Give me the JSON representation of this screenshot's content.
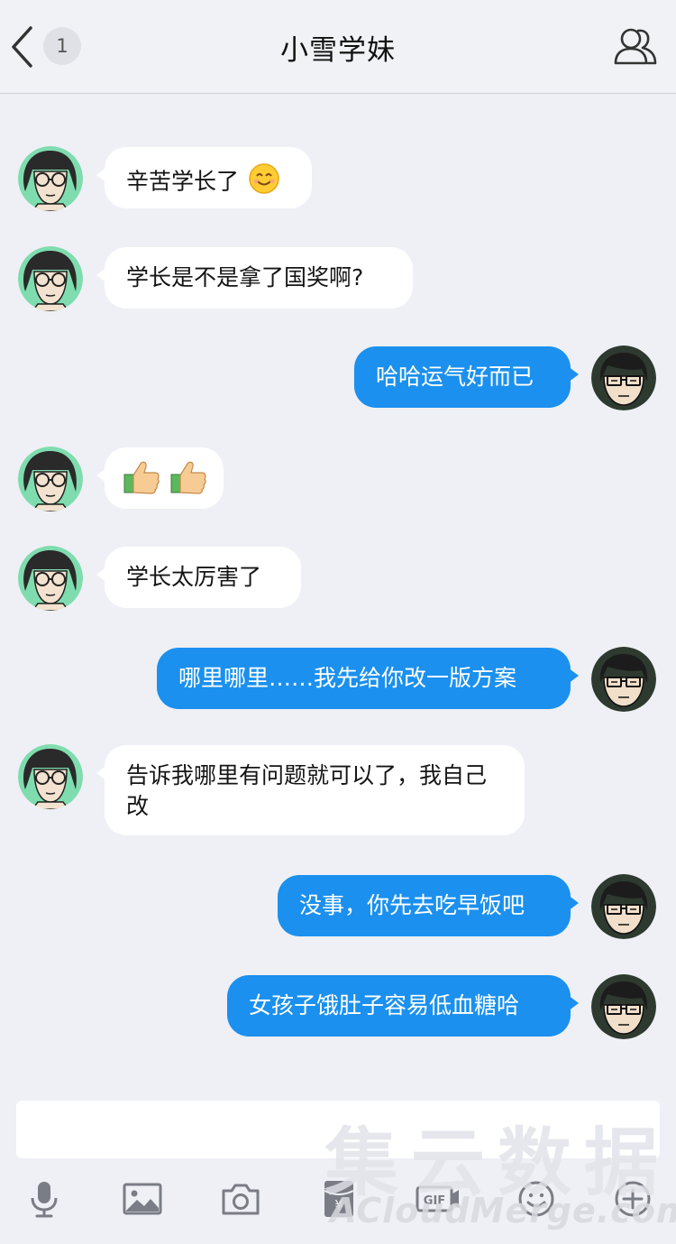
{
  "header": {
    "title": "小雪学妹",
    "unread_count": "1"
  },
  "messages": [
    {
      "side": "in",
      "text": "辛苦学长了",
      "emoji": "smiling-face-emoji"
    },
    {
      "side": "in",
      "text": "学长是不是拿了国奖啊?"
    },
    {
      "side": "out",
      "text": "哈哈运气好而已"
    },
    {
      "side": "in",
      "text": "",
      "emoji": "thumbs-up-emoji x2"
    },
    {
      "side": "in",
      "text": "学长太厉害了"
    },
    {
      "side": "out",
      "text": "哪里哪里……我先给你改一版方案"
    },
    {
      "side": "in",
      "text": "告诉我哪里有问题就可以了，我自己改"
    },
    {
      "side": "out",
      "text": "没事，你先去吃早饭吧"
    },
    {
      "side": "out",
      "text": "女孩子饿肚子容易低血糖哈"
    }
  ],
  "input": {
    "value": ""
  },
  "toolbar": [
    "microphone-icon",
    "image-icon",
    "camera-icon",
    "red-packet-icon",
    "gif-icon",
    "emoji-icon",
    "plus-icon"
  ],
  "watermark": {
    "line1": "集云数据",
    "line2": "ACloudMerge.com"
  },
  "colors": {
    "background": "#eef0f5",
    "outgoing_bubble": "#1b90ee",
    "incoming_bubble": "#ffffff"
  }
}
